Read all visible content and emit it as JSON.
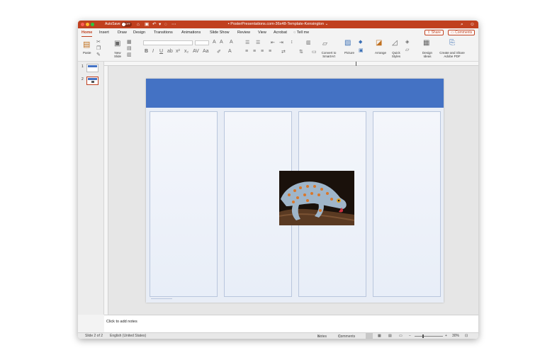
{
  "titlebar": {
    "autosave_label": "AutoSave",
    "autosave_state": "OFF",
    "document_title": "PosterPresentations.com-36x48-Template-Kensington",
    "colors": {
      "bar": "#c0401f"
    }
  },
  "menu": {
    "tabs": [
      "Home",
      "Insert",
      "Draw",
      "Design",
      "Transitions",
      "Animations",
      "Slide Show",
      "Review",
      "View",
      "Acrobat"
    ],
    "active_tab": "Home",
    "tell_me": "Tell me",
    "share_label": "Share",
    "comments_label": "Comments"
  },
  "ribbon": {
    "paste_label": "Paste",
    "new_slide_label": "New Slide",
    "convert_smartart_label": "Convert to SmartArt",
    "picture_label": "Picture",
    "arrange_label": "Arrange",
    "quick_styles_label": "Quick Styles",
    "design_ideas_label": "Design Ideas",
    "create_pdf_label": "Create and Share Adobe PDF"
  },
  "thumbnails": [
    {
      "number": "1"
    },
    {
      "number": "2"
    }
  ],
  "slide": {
    "header_color": "#4472c4",
    "column_count": 4,
    "image_description_icon": "gecko-photo"
  },
  "notes": {
    "placeholder": "Click to add notes"
  },
  "status": {
    "slide_position": "Slide 2 of 2",
    "language": "English (United States)",
    "notes_label": "Notes",
    "comments_label": "Comments",
    "zoom": "30%",
    "zoom_fraction": 0.3
  }
}
